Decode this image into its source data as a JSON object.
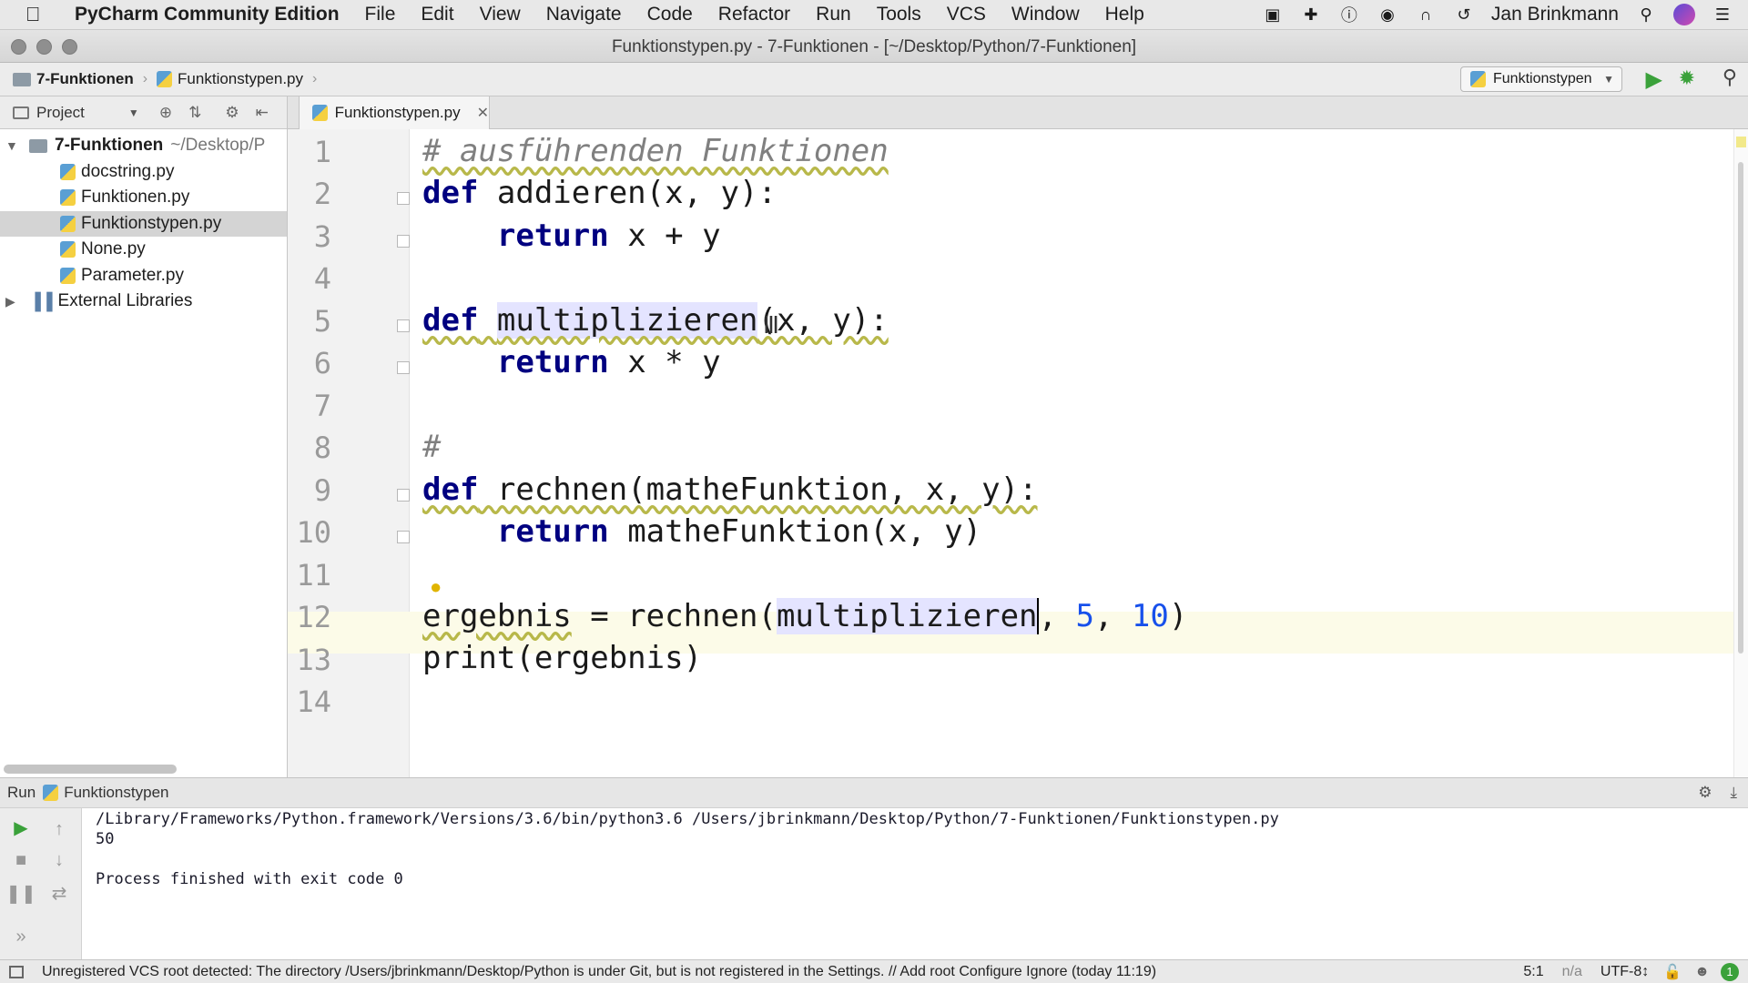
{
  "menubar": {
    "app_name": "PyCharm Community Edition",
    "items": [
      "File",
      "Edit",
      "View",
      "Navigate",
      "Code",
      "Refactor",
      "Run",
      "Tools",
      "VCS",
      "Window",
      "Help"
    ],
    "user": "Jan Brinkmann"
  },
  "window": {
    "title": "Funktionstypen.py - 7-Funktionen - [~/Desktop/Python/7-Funktionen]"
  },
  "navbar": {
    "breadcrumb_project": "7-Funktionen",
    "breadcrumb_file": "Funktionstypen.py",
    "run_config": "Funktionstypen"
  },
  "project": {
    "header": "Project",
    "root_name": "7-Funktionen",
    "root_path": "~/Desktop/P",
    "files": [
      "docstring.py",
      "Funktionen.py",
      "Funktionstypen.py",
      "None.py",
      "Parameter.py"
    ],
    "selected_file_index": 2,
    "external_libraries": "External Libraries"
  },
  "editor": {
    "tab_label": "Funktionstypen.py",
    "line_numbers": [
      "1",
      "2",
      "3",
      "4",
      "5",
      "6",
      "7",
      "8",
      "9",
      "10",
      "11",
      "12",
      "13",
      "14"
    ],
    "current_line": 12,
    "code": {
      "l1_comment": "# ausführenden Funktionen",
      "l2_def": "def",
      "l2_rest": " addieren(x, y):",
      "l3_indent": "    ",
      "l3_return": "return",
      "l3_rest": " x + y",
      "l5_def": "def",
      "l5_name": "multiplizieren",
      "l5_rest": "(x, y):",
      "l6_return": "return",
      "l6_rest": " x * y",
      "l8_comment": "#",
      "l9_def": "def",
      "l9_rest": " rechnen(matheFunktion, x, y):",
      "l10_return": "return",
      "l10_rest": " matheFunktion(x, y)",
      "l12_var": "ergebnis",
      "l12_mid": " = rechnen(",
      "l12_arg": "multiplizieren",
      "l12_sep1": ", ",
      "l12_n1": "5",
      "l12_sep2": ", ",
      "l12_n2": "10",
      "l12_end": ")",
      "l13_print": "print",
      "l13_rest": "(ergebnis)"
    }
  },
  "run_panel": {
    "label": "Run",
    "config": "Funktionstypen",
    "command": "/Library/Frameworks/Python.framework/Versions/3.6/bin/python3.6 /Users/jbrinkmann/Desktop/Python/7-Funktionen/Funktionstypen.py",
    "output": "50",
    "exit_message": "Process finished with exit code 0"
  },
  "statusbar": {
    "message": "Unregistered VCS root detected: The directory /Users/jbrinkmann/Desktop/Python is under Git, but is not registered in the Settings. // Add root  Configure  Ignore (today 11:19)",
    "position": "5:1",
    "lf": "n/a",
    "encoding": "UTF-8↕",
    "event_count": "1"
  }
}
